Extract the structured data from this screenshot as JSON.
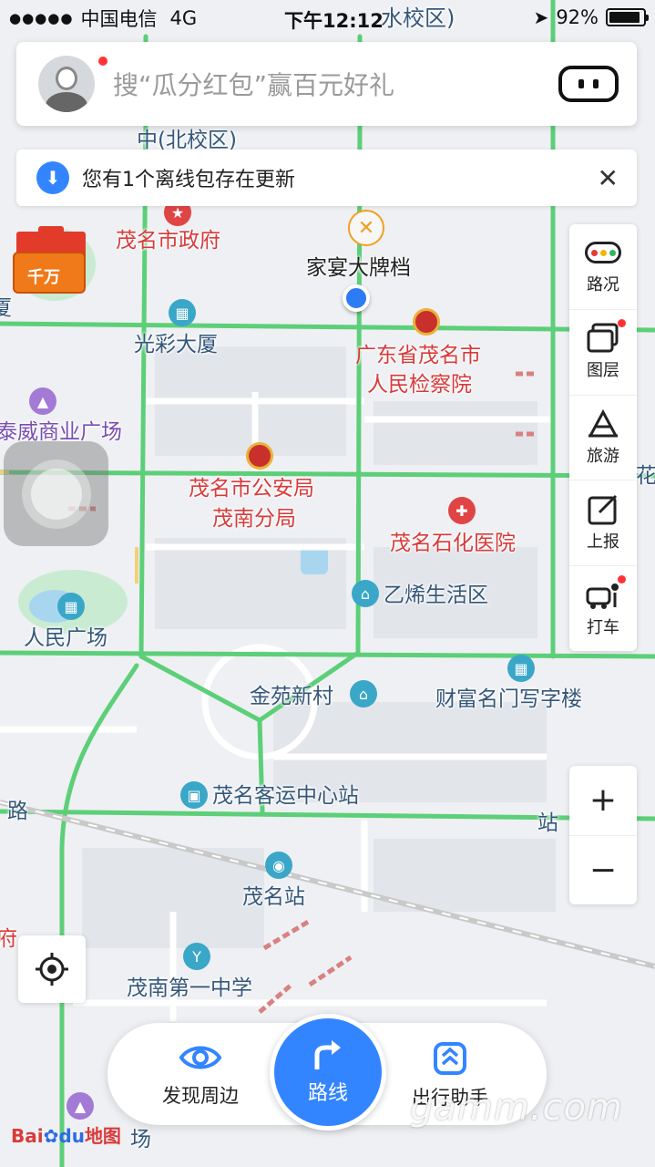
{
  "status_bar": {
    "signal": "●●●●●",
    "carrier": "中国电信",
    "network": "4G",
    "time": "下午12:12",
    "battery_text": "92%",
    "battery_level": 0.92
  },
  "search": {
    "placeholder": "搜“瓜分红包”赢百元好礼"
  },
  "offline_banner": {
    "message": "您有1个离线包存在更新",
    "close": "✕"
  },
  "promo": {
    "label": "千万"
  },
  "toolbar": {
    "items": [
      {
        "label": "路况",
        "icon": "traffic-light-icon"
      },
      {
        "label": "图层",
        "icon": "layers-icon"
      },
      {
        "label": "旅游",
        "icon": "travel-icon"
      },
      {
        "label": "上报",
        "icon": "report-icon"
      },
      {
        "label": "打车",
        "icon": "taxi-icon"
      }
    ]
  },
  "zoom": {
    "in": "+",
    "out": "−"
  },
  "map_labels": {
    "top_school": "水校区)",
    "north_school": "中(北校区)",
    "maoming_gov": "茂名市政府",
    "restaurant": "家宴大牌档",
    "guangcai": "光彩大厦",
    "procuratorate_1": "广东省茂名市",
    "procuratorate_2": "人民检察院",
    "commercial": "泰威商业广场",
    "police_1": "茂名市公安局",
    "police_2": "茂南分局",
    "hospital": "茂名石化医院",
    "ethylene": "乙烯生活区",
    "peoples_square": "人民广场",
    "jinyuan": "金苑新村",
    "caifu": "财富名门写字楼",
    "bus_station": "茂名客运中心站",
    "station_road": "站",
    "road_left": "路",
    "left_edge_1": "厦",
    "left_edge_2": "府",
    "right_edge": "花",
    "maoming_station": "茂名站",
    "maonan_school": "茂南第一中学",
    "bottom_square": "场"
  },
  "bottom_bar": {
    "discover": "发现周边",
    "route": "路线",
    "assistant": "出行助手"
  },
  "logo": {
    "bai": "Bai",
    "du": "du",
    "map": "地图"
  },
  "watermark": "gamm.com",
  "colors": {
    "road_green": "#5ccf78",
    "accent_blue": "#3385ff",
    "poi_red": "#d93a3a",
    "poi_blue": "#35577a"
  }
}
